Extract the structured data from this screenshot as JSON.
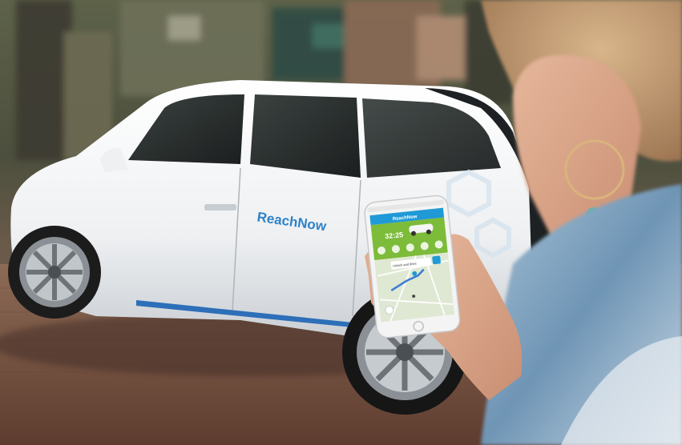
{
  "photo": {
    "car_brand_text": "ReachNow",
    "app": {
      "brand": "ReachNow",
      "timer": "32:25",
      "map_tooltip": "Unlock and drive",
      "colors": {
        "header": "#1f9ad6",
        "banner": "#7dbb3a",
        "map": "#dfe8d2",
        "route": "#3b7bd6"
      }
    }
  }
}
